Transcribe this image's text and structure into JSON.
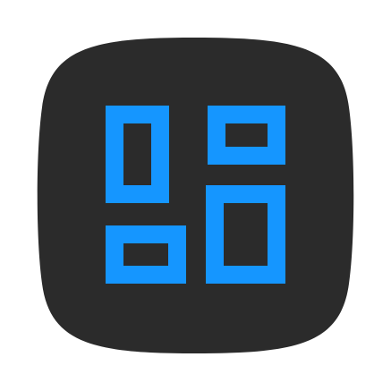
{
  "app_icon": {
    "icon_name": "dashboard-layout-icon",
    "colors": {
      "background_tile": "#2b2b2b",
      "glyph": "#1596ff",
      "page": "#ffffff"
    }
  }
}
